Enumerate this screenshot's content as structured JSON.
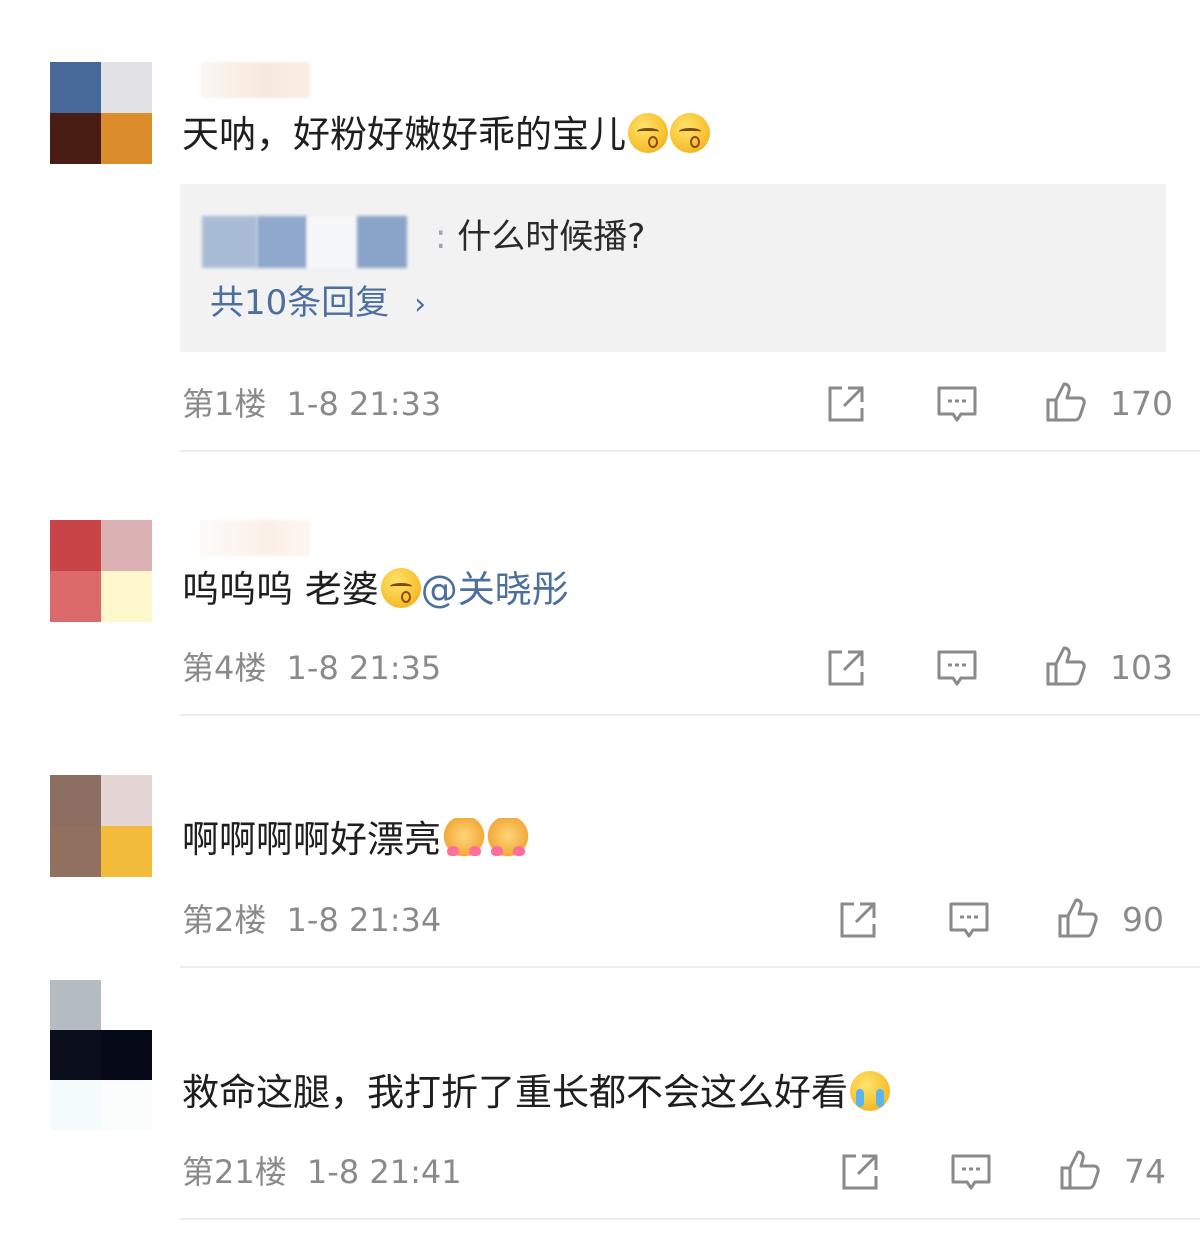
{
  "comments": [
    {
      "content_text": "天呐，好粉好嫩好乖的宝儿",
      "emojis": [
        "kiss-face",
        "kiss-face"
      ],
      "reply_preview": {
        "separator": ":",
        "text": "什么时候播?",
        "more_label": "共10条回复",
        "more_icon": "chevron-right-icon"
      },
      "floor": "第1楼",
      "time": "1-8 21:33",
      "likes": "170"
    },
    {
      "content_text": "呜呜呜 老婆",
      "emojis": [
        "kiss-face"
      ],
      "mention": "@关晓彤",
      "floor": "第4楼",
      "time": "1-8 21:35",
      "likes": "103"
    },
    {
      "content_text": "啊啊啊啊好漂亮",
      "emojis": [
        "cat-heart",
        "cat-heart"
      ],
      "floor": "第2楼",
      "time": "1-8 21:34",
      "likes": "90"
    },
    {
      "content_text": "救命这腿，我打折了重长都不会这么好看",
      "emojis": [
        "crying-face"
      ],
      "floor": "第21楼",
      "time": "1-8 21:41",
      "likes": "74"
    }
  ],
  "actions": {
    "share_icon": "share-icon",
    "comment_icon": "comment-icon",
    "like_icon": "thumbs-up-icon"
  },
  "colors": {
    "link": "#4c6f9e",
    "meta": "#8a8a8a",
    "reply_bg": "#f2f2f2",
    "divider": "#ededed"
  }
}
